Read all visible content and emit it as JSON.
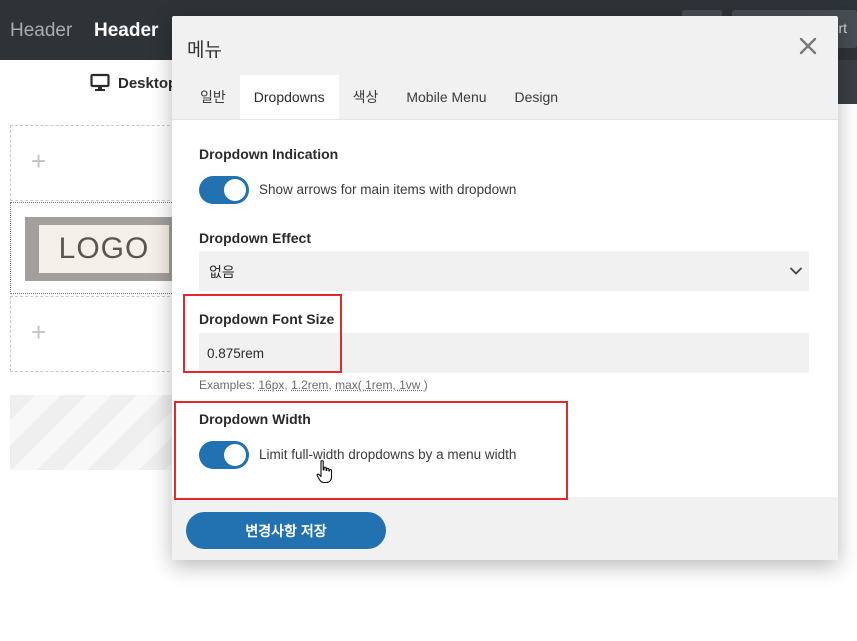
{
  "topbar": {
    "crumb_muted": "Header",
    "crumb_active": "Header",
    "button_text_partial": "rt"
  },
  "subbar": {
    "device_label": "Desktop"
  },
  "canvas": {
    "logo_text": "LOGO",
    "add_row_symbol": "+"
  },
  "modal": {
    "title": "메뉴",
    "tabs": [
      {
        "label": "일반",
        "active": false
      },
      {
        "label": "Dropdowns",
        "active": true
      },
      {
        "label": "색상",
        "active": false
      },
      {
        "label": "Mobile Menu",
        "active": false
      },
      {
        "label": "Design",
        "active": false
      }
    ],
    "fields": {
      "dropdown_indication": {
        "label": "Dropdown Indication",
        "toggle_on": true,
        "toggle_text": "Show arrows for main items with dropdown"
      },
      "dropdown_effect": {
        "label": "Dropdown Effect",
        "value": "없음"
      },
      "dropdown_font_size": {
        "label": "Dropdown Font Size",
        "value": "0.875rem",
        "examples_prefix": "Examples: ",
        "examples": [
          "16px",
          "1.2rem",
          "max( 1rem, 1vw )"
        ]
      },
      "dropdown_width": {
        "label": "Dropdown Width",
        "toggle_on": true,
        "toggle_text": "Limit full-width dropdowns by a menu width"
      }
    },
    "save_label": "변경사항 저장"
  },
  "colors": {
    "accent": "#2271b1",
    "topbar_bg": "#2e3338",
    "highlight": "#e12b2b",
    "input_bg": "#f1f1f1"
  },
  "icons": [
    "desktop-icon",
    "close-icon",
    "chevron-down-icon",
    "hand-pointer-icon"
  ]
}
